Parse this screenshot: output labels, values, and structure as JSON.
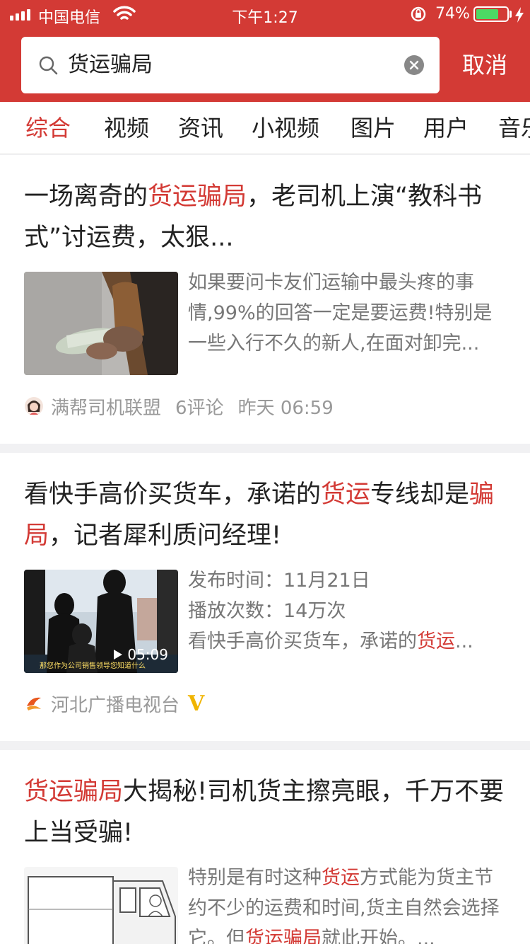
{
  "status_bar": {
    "carrier": "中国电信",
    "time": "下午1:27",
    "battery": "74%",
    "battery_level": 0.74
  },
  "search": {
    "query": "货运骗局",
    "cancel_label": "取消"
  },
  "tabs": [
    {
      "label": "综合",
      "active": true
    },
    {
      "label": "视频"
    },
    {
      "label": "资讯"
    },
    {
      "label": "小视频"
    },
    {
      "label": "图片"
    },
    {
      "label": "用户"
    },
    {
      "label": "音乐"
    }
  ],
  "articles": [
    {
      "title": [
        {
          "text": "一场离奇的"
        },
        {
          "text": "货运骗局",
          "highlight": true
        },
        {
          "text": "，老司机上演“教科书式”讨运费，太狠..."
        }
      ],
      "description": [
        {
          "text": "如果要问卡友们运输中最头疼的事情,99%的回答一定是要运费!特别是一些入行不久的新人,在面对卸完..."
        }
      ],
      "source": "满帮司机联盟",
      "comments": "6评论",
      "time": "昨天 06:59"
    },
    {
      "title": [
        {
          "text": "看快手高价买货车，承诺的"
        },
        {
          "text": "货运",
          "highlight": true
        },
        {
          "text": "专线却是"
        },
        {
          "text": "骗局",
          "highlight": true
        },
        {
          "text": "，记者犀利质问经理!"
        }
      ],
      "publish_time": "发布时间：11月21日",
      "play_count": "播放次数：14万次",
      "description": [
        {
          "text": "看快手高价买货车，承诺的"
        },
        {
          "text": "货运",
          "highlight": true
        },
        {
          "text": "..."
        }
      ],
      "duration": "05:09",
      "video_caption": "那您作为公司销售领导您知道什么",
      "source": "河北广播电视台",
      "verified_badge": "V"
    },
    {
      "title": [
        {
          "text": "货运骗局",
          "highlight": true
        },
        {
          "text": "大揭秘!司机货主擦亮眼，千万不要上当受骗!"
        }
      ],
      "description": [
        {
          "text": "特别是有时这种"
        },
        {
          "text": "货运",
          "highlight": true
        },
        {
          "text": "方式能为货主节约不少的运费和时间,货主自然会选择它。但"
        },
        {
          "text": "货运骗局",
          "highlight": true
        },
        {
          "text": "就此开始。..."
        }
      ]
    }
  ],
  "colors": {
    "brand_red": "#d33a35",
    "text": "#222222",
    "secondary_text": "#777777",
    "meta_text": "#999999",
    "battery_green": "#4cd964"
  }
}
